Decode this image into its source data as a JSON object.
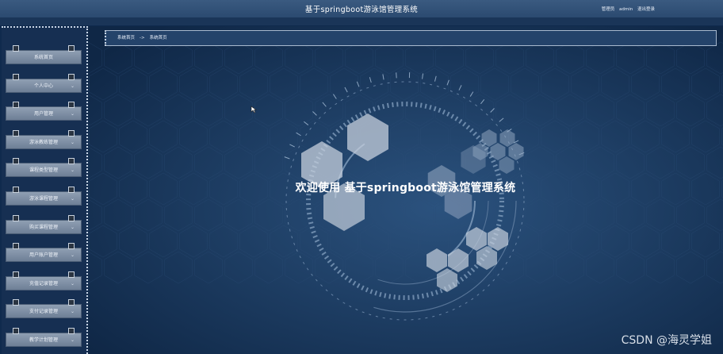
{
  "header": {
    "title": "基于springboot游泳馆管理系统",
    "user_role": "管理员",
    "user_name": "admin",
    "logout_label": "退出登录"
  },
  "sidebar": {
    "items": [
      {
        "label": "系统首页",
        "has_submenu": false
      },
      {
        "label": "个人中心",
        "has_submenu": true
      },
      {
        "label": "用户管理",
        "has_submenu": true
      },
      {
        "label": "游泳教练管理",
        "has_submenu": true
      },
      {
        "label": "课程类型管理",
        "has_submenu": true
      },
      {
        "label": "游泳课程管理",
        "has_submenu": true
      },
      {
        "label": "购买课程管理",
        "has_submenu": true
      },
      {
        "label": "用户账户管理",
        "has_submenu": true
      },
      {
        "label": "充值记录管理",
        "has_submenu": true
      },
      {
        "label": "支付记录管理",
        "has_submenu": true
      },
      {
        "label": "教学计划管理",
        "has_submenu": true
      }
    ]
  },
  "breadcrumb": {
    "home": "系统首页",
    "separator": "->",
    "current": "系统首页"
  },
  "main": {
    "welcome": "欢迎使用 基于springboot游泳馆管理系统"
  },
  "watermark": "CSDN @海灵学姐",
  "colors": {
    "background": "#0f2a4d",
    "topbar": "#2b4a70",
    "menu_item": "#7f90a6",
    "accent": "#ffffff"
  }
}
